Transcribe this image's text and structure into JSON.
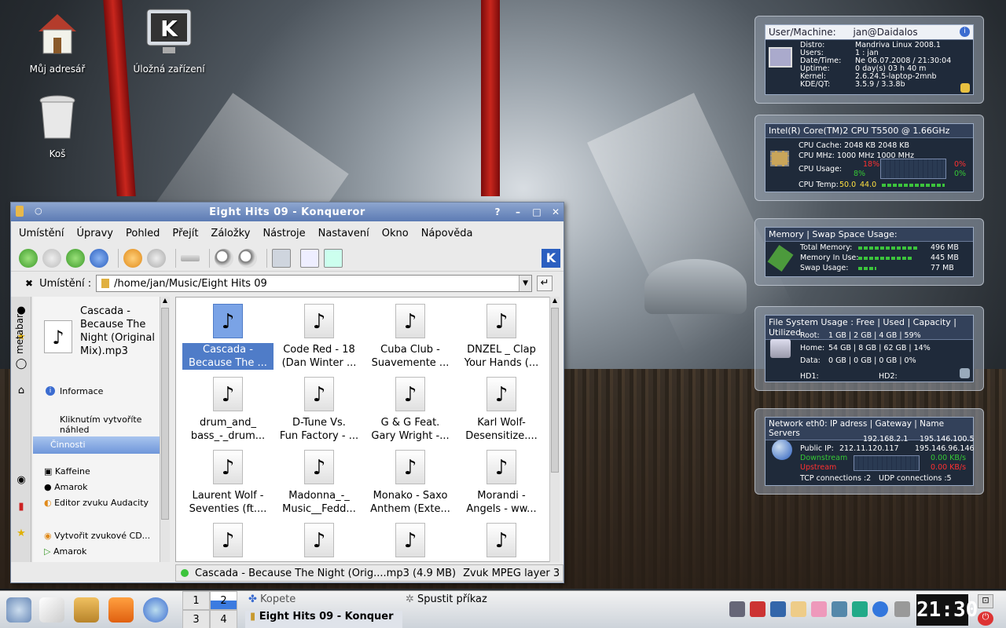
{
  "desktop": {
    "icons": [
      {
        "label": "Můj adresář",
        "icon": "home-folder-icon"
      },
      {
        "label": "Úložná zařízení",
        "icon": "storage-devices-icon"
      },
      {
        "label": "Koš",
        "icon": "trash-icon"
      }
    ]
  },
  "window": {
    "title": "Eight Hits 09 - Konqueror",
    "title_buttons": [
      "?",
      "–",
      "□",
      "✕"
    ],
    "menu": [
      "Umístění",
      "Úpravy",
      "Pohled",
      "Přejít",
      "Záložky",
      "Nástroje",
      "Nastavení",
      "Okno",
      "Nápověda"
    ],
    "location_label": "Umístění :",
    "location_value": "/home/jan/Music/Eight Hits 09",
    "sidebar": {
      "tab_label": "metabar",
      "file_name": "Cascada - Because The Night (Original Mix).mp3",
      "info_label": "Informace",
      "preview_hint": "Kliknutím vytvoříte náhled",
      "actions_header": "Činnosti",
      "actions": [
        "Kaffeine",
        "Amarok",
        "Editor zvuku Audacity"
      ],
      "actions2": [
        "Vytvořit zvukové CD...",
        "Amarok"
      ]
    },
    "files": [
      {
        "l1": "Cascada -",
        "l2": "Because The ...",
        "selected": true
      },
      {
        "l1": "Code Red - 18",
        "l2": "(Dan Winter ...",
        "selected": false
      },
      {
        "l1": "Cuba Club -",
        "l2": "Suavemente ...",
        "selected": false
      },
      {
        "l1": "DNZEL _ Clap",
        "l2": "Your Hands (...",
        "selected": false
      },
      {
        "l1": "drum_and_",
        "l2": "bass_-_drum...",
        "selected": false
      },
      {
        "l1": "D-Tune Vs.",
        "l2": "Fun Factory - ...",
        "selected": false
      },
      {
        "l1": "G & G Feat.",
        "l2": "Gary Wright -...",
        "selected": false
      },
      {
        "l1": "Karl Wolf-",
        "l2": "Desensitize....",
        "selected": false
      },
      {
        "l1": "Laurent Wolf -",
        "l2": "Seventies (ft....",
        "selected": false
      },
      {
        "l1": "Madonna_-_",
        "l2": "Music__Fedd...",
        "selected": false
      },
      {
        "l1": "Monako - Saxo",
        "l2": "Anthem (Exte...",
        "selected": false
      },
      {
        "l1": "Morandi -",
        "l2": "Angels - ww...",
        "selected": false
      },
      {
        "l1": "",
        "l2": "",
        "selected": false
      },
      {
        "l1": "",
        "l2": "",
        "selected": false
      },
      {
        "l1": "",
        "l2": "",
        "selected": false
      },
      {
        "l1": "",
        "l2": "",
        "selected": false
      }
    ],
    "status_text": "Cascada - Because The Night (Orig....mp3 (4.9 MB)",
    "status_type": "Zvuk MPEG layer 3"
  },
  "widgets": {
    "system": {
      "header_label": "User/Machine:",
      "header_value": "jan@Daidalos",
      "rows": [
        [
          "Distro:",
          "Mandriva Linux 2008.1"
        ],
        [
          "Users:",
          "1 : jan"
        ],
        [
          "Date/Time:",
          "Ne 06.07.2008 / 21:30:04"
        ],
        [
          "Uptime:",
          "0 day(s) 03 h 40 m"
        ],
        [
          "Kernel:",
          "2.6.24.5-laptop-2mnb"
        ],
        [
          "KDE/QT:",
          "3.5.9          /   3.3.8b"
        ]
      ]
    },
    "cpu": {
      "header": "Intel(R) Core(TM)2 CPU T5500 @ 1.66GHz",
      "cache": "CPU Cache:  2048 KB 2048 KB",
      "mhz": "CPU MHz:    1000 MHz 1000 MHz",
      "usage_label": "CPU Usage:",
      "usage1": "18%",
      "usage2": "8%",
      "usage3": "0%",
      "usage4": "0%",
      "temp_label": "CPU Temp:",
      "temp1": "50.0",
      "temp2": "44.0"
    },
    "memory": {
      "header": "Memory | Swap Space Usage:",
      "rows": [
        {
          "label": "Total Memory:",
          "value": "496 MB",
          "fill": 1.0
        },
        {
          "label": "Memory In Use:",
          "value": "445 MB",
          "fill": 0.9
        },
        {
          "label": "Swap Usage:",
          "value": "77 MB",
          "fill": 0.3
        }
      ]
    },
    "filesystem": {
      "header": "File System Usage : Free | Used | Capacity | Utilized",
      "rows": [
        [
          "Root:",
          "1 GB | 2 GB  | 4 GB | 59%"
        ],
        [
          "Home:",
          "54 GB | 8 GB | 62 GB | 14%"
        ],
        [
          "Data:",
          "0 GB | 0 GB | 0 GB | 0%"
        ]
      ],
      "hd1": "HD1:",
      "hd2": "HD2:"
    },
    "network": {
      "header": "Network eth0: IP adress |  Gateway  |   Name Servers",
      "local_ip": "192.168.2.1",
      "ns1": "195.146.100.5",
      "public_label": "Public IP:",
      "public_ip": "212.11.120.117",
      "ns2": "195.146.96.146",
      "down_label": "Downstream",
      "down_value": "0.00 KB/s",
      "up_label": "Upstream",
      "up_value": "0.00 KB/s",
      "tcp": "TCP connections :2",
      "udp": "UDP connections :5"
    }
  },
  "taskbar": {
    "pager": [
      "1",
      "2",
      "3",
      "4"
    ],
    "tasks": [
      {
        "label": "Kopete",
        "active": false
      },
      {
        "label": "Spustit příkaz",
        "active": false
      },
      {
        "label": "Eight Hits 09 - Konquer",
        "active": true
      }
    ],
    "clock": "21:30"
  },
  "colors": {
    "accent": "#4f7cc8",
    "titlebar": "#5c7bb4",
    "cpu_red": "#ff3030",
    "cpu_green": "#35c835",
    "net_green": "#35c835",
    "net_red": "#ff3030"
  }
}
